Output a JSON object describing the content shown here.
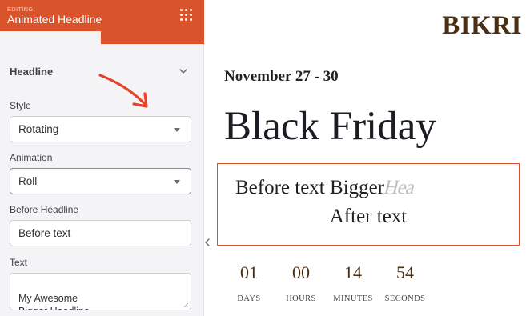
{
  "editor": {
    "eyebrow": "EDITING:",
    "title": "Animated Headline",
    "menu_icon": "grid-dots-icon",
    "accent_color": "#d9532b"
  },
  "headline_section": {
    "title": "Headline",
    "chevron_icon": "chevron-down-icon"
  },
  "fields": {
    "style": {
      "label": "Style",
      "value": "Rotating"
    },
    "animation": {
      "label": "Animation",
      "value": "Roll"
    },
    "before_headline": {
      "label": "Before Headline",
      "value": "Before text"
    },
    "text": {
      "label": "Text",
      "value": "My Awesome\nBigger Headline"
    }
  },
  "preview": {
    "brand": "BIKRI",
    "date": "November 27 - 30",
    "headline": "Black Friday",
    "animated": {
      "before": "Before text",
      "rolling": "Bigger",
      "rolling_tail": "Hea",
      "after": "After text"
    },
    "countdown": [
      {
        "value": "01",
        "unit": "DAYS"
      },
      {
        "value": "00",
        "unit": "HOURS"
      },
      {
        "value": "14",
        "unit": "MINUTES"
      },
      {
        "value": "54",
        "unit": "SECONDS"
      }
    ]
  }
}
